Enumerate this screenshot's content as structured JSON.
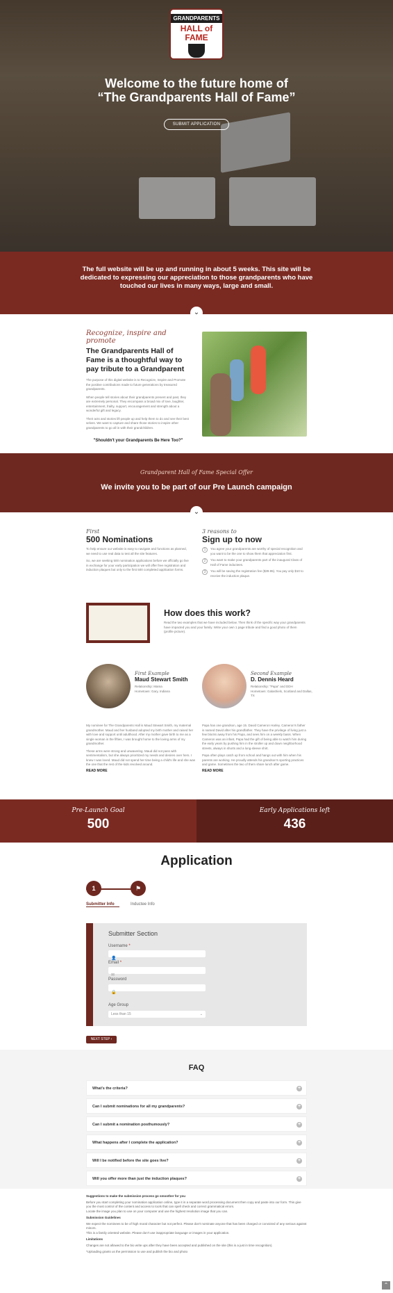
{
  "hero": {
    "logo_line1": "GRANDPARENTS",
    "logo_line2": "HALL of FAME",
    "title_line1": "Welcome to the future home of",
    "title_line2": "“The Grandparents Hall of Fame”",
    "submit_button": "SUBMIT APPLICATION"
  },
  "band1": {
    "text": "The full website will be up and running in about 5 weeks. This site will be dedicated to expressing our appreciation to those grandparents who have touched our lives in many ways, large and small."
  },
  "about": {
    "kicker": "Recognize, inspire and promote",
    "heading": "The Grandparents Hall of Fame is a thoughtful way to pay tribute to a Grandparent",
    "p1": "The purpose of this digital website is to Recognize, Inspire and Promote the positive contributions made to future generations by treasured grandparents.",
    "p2": "When people tell stories about their grandparents present and past, they are extremely personal. They encompass a broad mix of love, laughter, entertainment, frailty, support, encouragement and strength about a wonderful gift and legacy.",
    "p3": "Their acts and stories lift people up and help them to do and see their best selves. We want to capture and share those stories to inspire other grandparents to go all in with their grandchildren.",
    "quote": "\"Shouldn't your Grandparents Be Here Too?\""
  },
  "special": {
    "kicker": "Grandparent Hall of Fame Special Offer",
    "title": "We invite you to be part of our Pre Launch campaign"
  },
  "nominations": {
    "kicker": "First",
    "heading": "500 Nominations",
    "p1": "To help ensure our website is easy to navigate and functions as planned, we need to use real data to test all the site features.",
    "p2": "So, we are seeking 500 nomination applications before we officially go live in exchange for your early participation we will offer free registration and induction plaques but only to the first 500 completed application forms.",
    "r_kicker": "3 reasons to",
    "r_heading": "Sign up to now",
    "reasons": [
      "You agree your grandparents are worthy of special recognition and you want to be the one to show them that appreciation first.",
      "You want to make your grandparents part of the inaugural Class of Hall of Fame inductees.",
      "You will be saving the registration fee ($39.95). You pay only $10 to receive the induction plaque."
    ]
  },
  "howto": {
    "heading": "How does this work?",
    "text": "Read the two examples that we have included below. Then think of the specific way your grandparents have impacted you and your family. Write your own 1 page tribute and find a good photo of them (profile picture)."
  },
  "examples": [
    {
      "kicker": "First Example",
      "name": "Maud Stewart Smith",
      "relation": "Relationship: Mama",
      "home": "Hometown: Gary, Indiana",
      "p1": "My nominee for The Grandparents Hall is Maud Stewart Smith, my maternal grandmother. Maud and her husband adopted my birth mother and raised her with love and support until adulthood. After my mother gave birth to me as a single woman in the fifties, I was brought home to the loving arms of my grandmother.",
      "p2": "These arms were strong and unwavering. Maud did not pass with sentimentalism, but she always prioritized my needs and desires over hers. I knew I was loved. Maud did not spend her time being a child's life and she was the one that the rest of the kids revolved around.",
      "more": "READ MORE"
    },
    {
      "kicker": "Second Example",
      "name": "D. Dennis Heard",
      "relation": "Relationship: \"Papa\" and DDH",
      "home": "Hometown: Galashiels, Scotland and Dallas, TX",
      "p1": "Papa has one grandson, age 15. David Cameron Harley. Cameron's father is named David after his grandfather. They have the privilege of living just a few blocks away from his Papa, and sees him on a weekly basis. When Cameron was an infant, Papa had the gift of being able to watch him during the early years by pushing him in the stroller up and down neighborhood streets, always in shorts and a long-sleeve shirt.",
      "p2": "Papa often plays catch up from school and hangs out with him when his parents are working. He proudly attends his grandson's sporting practices and game. Sometimes the two of them share lunch after game.",
      "more": "READ MORE"
    }
  ],
  "stats": [
    {
      "label": "Pre-Launch Goal",
      "value": "500"
    },
    {
      "label": "Early Applications left",
      "value": "436"
    }
  ],
  "application": {
    "heading": "Application",
    "steps": [
      {
        "num": "1",
        "label": "Submitter Info"
      },
      {
        "num": "",
        "label": "Inductee Info"
      }
    ],
    "section_title": "Submitter Section",
    "fields": [
      {
        "label": "Username",
        "required": "*"
      },
      {
        "label": "Email",
        "required": "*"
      },
      {
        "label": "Password",
        "required": ""
      }
    ],
    "age_label": "Age Group",
    "age_value": "Less than 15",
    "next_button": "NEXT STEP"
  },
  "faq": {
    "heading": "FAQ",
    "items": [
      "What's the criteria?",
      "Can I submit nominations for all my grandparents?",
      "Can I submit a nomination posthumously?",
      "What happens after I complete the application?",
      "Will I be notified before the site goes live?",
      "Will you offer more than just the induction plaques?"
    ]
  },
  "notes": {
    "title1": "Suggestions to make the submission process go smoother for you",
    "s1": "Before you start completing your nomination application online, type it in a separate word processing document then copy and paste into our form. This give you the most control of the content and access to tools that can spell check and correct grammatical errors.",
    "s2": "Locate the image you plan to use on your computer and use the highest resolution image that you can.",
    "title2": "Submission Guidelines",
    "g1": "We expect the nominees to be of high moral character but not perfect. Please don't nominate anyone that has been charged or convicted of any serious against minors.",
    "g2": "This is a family oriented website. Please don't use inappropriate language or images in your application.",
    "title3": "Limitations",
    "l1": "Changes are not allowed to the bio write ups after they have been accepted and published on the site (this is a just in time recognition).",
    "l2": "*Uploading grants us the permission to use and publish the bio and photo"
  },
  "colors": {
    "brand": "#7b2a22",
    "brand_dark": "#5a1f19"
  }
}
